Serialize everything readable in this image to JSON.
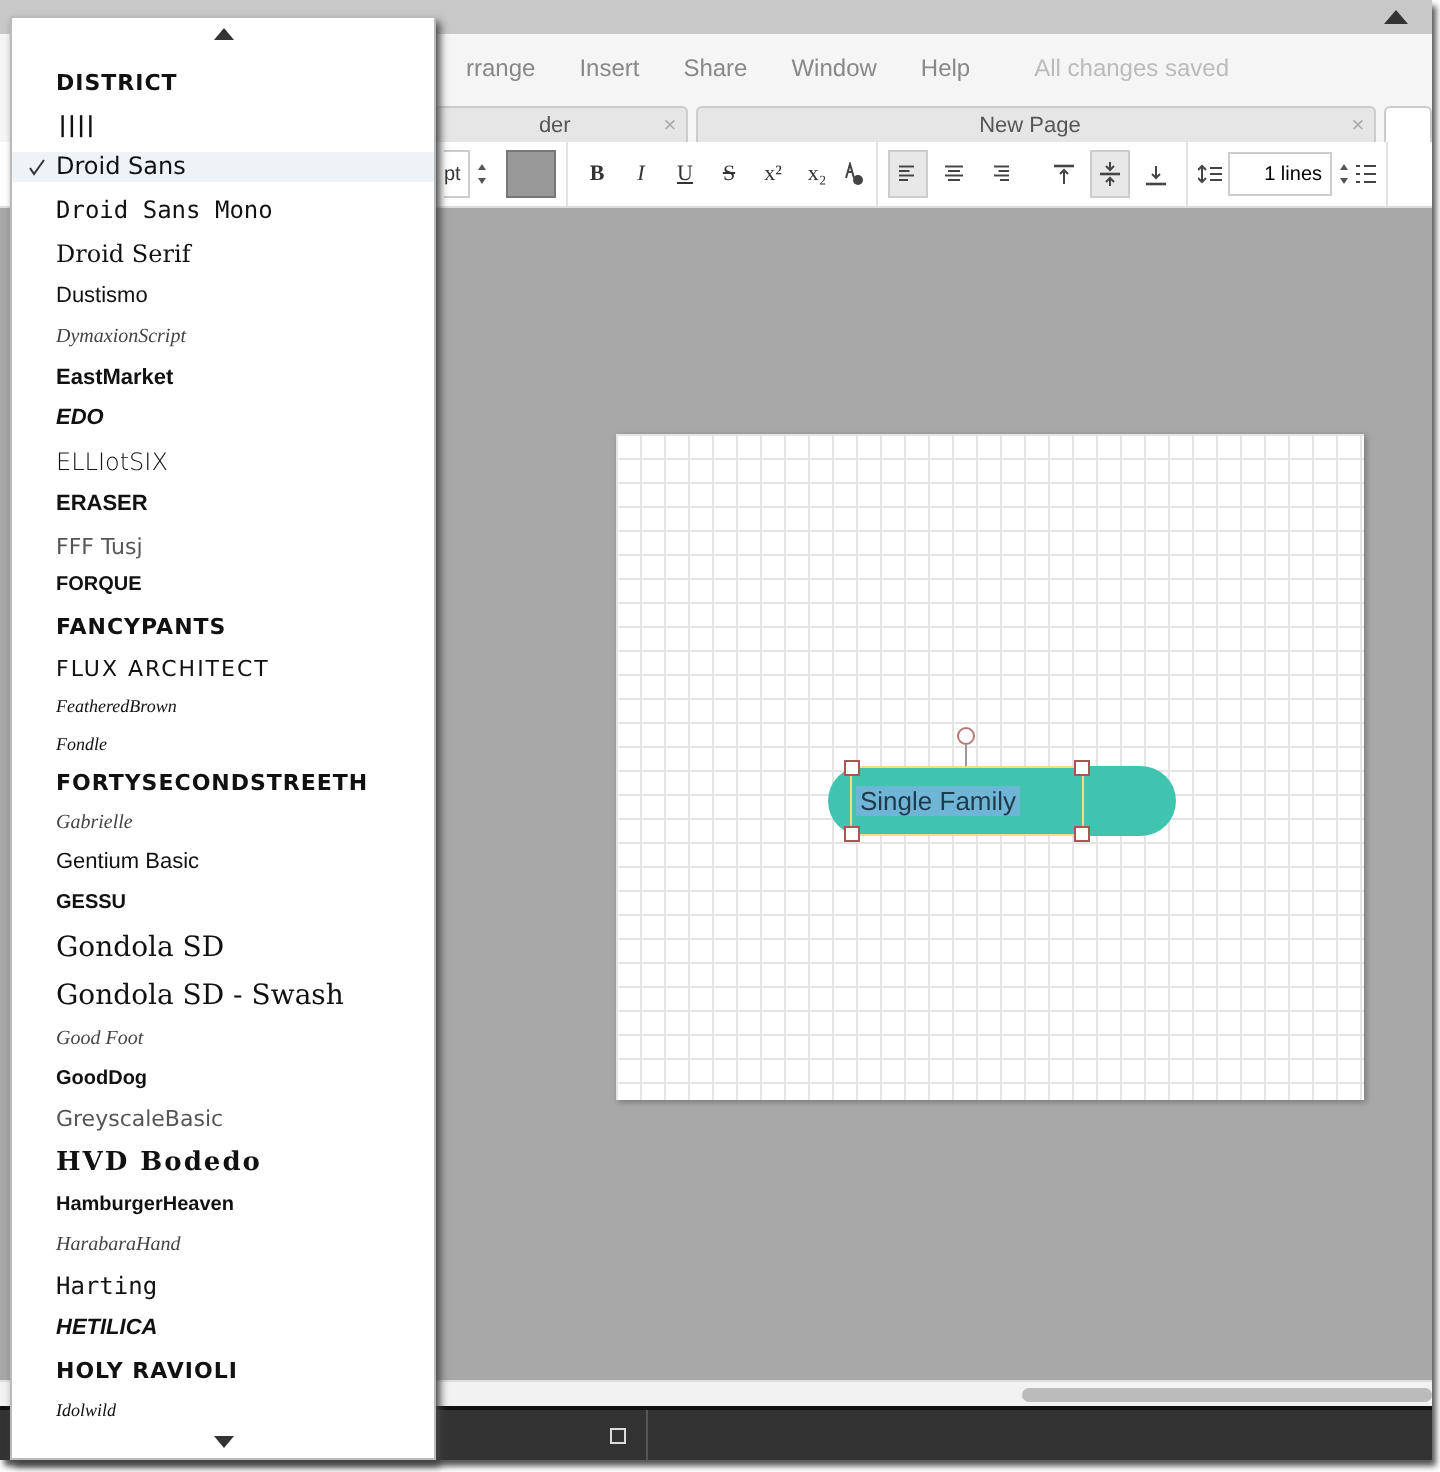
{
  "menu": {
    "items": [
      "rrange",
      "Insert",
      "Share",
      "Window",
      "Help"
    ],
    "status": "All changes saved"
  },
  "tabs": [
    {
      "label": "der",
      "close": "×",
      "selected": false
    },
    {
      "label": "New Page",
      "close": "×",
      "selected": false
    },
    {
      "selected": true
    }
  ],
  "toolbar": {
    "size": "pt",
    "format_buttons": [
      {
        "label": "B",
        "kind": "bold"
      },
      {
        "label": "I",
        "kind": "italic"
      },
      {
        "label": "U",
        "kind": "underline"
      },
      {
        "label": "S",
        "kind": "strike"
      },
      {
        "label": "x²",
        "kind": "plain"
      },
      {
        "label": "x₂",
        "kind": "plain"
      }
    ],
    "align": [
      {
        "kind": "left",
        "selected": true
      },
      {
        "kind": "center",
        "selected": false
      },
      {
        "kind": "right",
        "selected": false
      }
    ],
    "valign": [
      {
        "kind": "top",
        "selected": false
      },
      {
        "kind": "middle",
        "selected": true
      },
      {
        "kind": "bottom",
        "selected": false
      }
    ],
    "spacing": "1 lines"
  },
  "shape": {
    "text": "Single Family",
    "selected": true
  },
  "font_menu": {
    "items": [
      {
        "label": "DISTRICT",
        "kind": "stencil",
        "selected": false
      },
      {
        "label": "||||",
        "kind": "barcode",
        "selected": false
      },
      {
        "label": "Droid Sans",
        "kind": "sans",
        "selected": true
      },
      {
        "label": "Droid Sans Mono",
        "kind": "mono",
        "selected": false
      },
      {
        "label": "Droid Serif",
        "kind": "serif",
        "selected": false
      },
      {
        "label": "Dustismo",
        "kind": "small",
        "selected": false
      },
      {
        "label": "DymaxionScript",
        "kind": "script",
        "selected": false
      },
      {
        "label": "EastMarket",
        "kind": "bold",
        "selected": false
      },
      {
        "label": "EDO",
        "kind": "italicbold",
        "selected": false
      },
      {
        "label": "ELLIotSIX",
        "kind": "thin",
        "selected": false
      },
      {
        "label": "ERASER",
        "kind": "bold",
        "selected": false
      },
      {
        "label": "FFF Tusj",
        "kind": "grey",
        "selected": false
      },
      {
        "label": "FORQUE",
        "kind": "condensed",
        "selected": false
      },
      {
        "label": "FANCYPANTS",
        "kind": "heavy",
        "selected": false
      },
      {
        "label": "FLUX ARCHITECT",
        "kind": "wide",
        "selected": false
      },
      {
        "label": "FeatheredBrown",
        "kind": "tinyscript",
        "selected": false
      },
      {
        "label": "Fondle",
        "kind": "tinyscript",
        "selected": false
      },
      {
        "label": "FORTYSECONDSTREETH",
        "kind": "heavy",
        "selected": false
      },
      {
        "label": "Gabrielle",
        "kind": "script",
        "selected": false
      },
      {
        "label": "Gentium Basic",
        "kind": "small",
        "selected": false
      },
      {
        "label": "GESSU",
        "kind": "condensed",
        "selected": false
      },
      {
        "label": "Gondola SD",
        "kind": "large",
        "selected": false
      },
      {
        "label": "Gondola SD - Swash",
        "kind": "large",
        "selected": false
      },
      {
        "label": "Good Foot",
        "kind": "script",
        "selected": false
      },
      {
        "label": "GoodDog",
        "kind": "condensed",
        "selected": false
      },
      {
        "label": "GreyscaleBasic",
        "kind": "grey",
        "selected": false
      },
      {
        "label": "HVD Bodedo",
        "kind": "heavyserif",
        "selected": false
      },
      {
        "label": "HamburgerHeaven",
        "kind": "condensed",
        "selected": false
      },
      {
        "label": "HarabaraHand",
        "kind": "script",
        "selected": false
      },
      {
        "label": "Harting",
        "kind": "mono",
        "selected": false
      },
      {
        "label": "HETILICA",
        "kind": "italicbold",
        "selected": false
      },
      {
        "label": "HOLY RAVIOLI",
        "kind": "heavy",
        "selected": false
      },
      {
        "label": "Idolwild",
        "kind": "tinyscript",
        "selected": false
      }
    ]
  }
}
